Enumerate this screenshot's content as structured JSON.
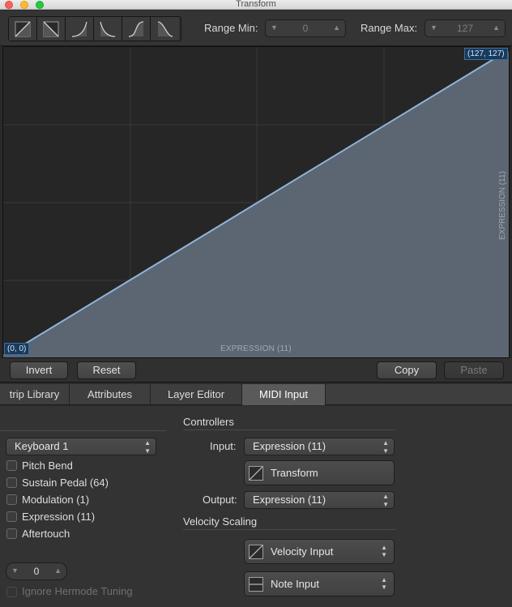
{
  "window": {
    "title": "Transform"
  },
  "toolbar": {
    "curve_buttons": [
      "linear-up-icon",
      "linear-down-icon",
      "exp-curve-icon",
      "log-curve-icon",
      "s-curve-icon",
      "bell-curve-icon"
    ],
    "range_min_label": "Range Min:",
    "range_min_value": "0",
    "range_max_label": "Range Max:",
    "range_max_value": "127"
  },
  "graph": {
    "start_point": "(0, 0)",
    "end_point": "(127, 127)",
    "x_axis_label": "EXPRESSION (11)",
    "y_axis_label": "EXPRESSION (11)",
    "line_color": "#8fb4d9",
    "fill_color": "#5b6672",
    "curve": {
      "x": [
        0,
        127
      ],
      "y": [
        0,
        127
      ]
    }
  },
  "buttons": {
    "invert": "Invert",
    "reset": "Reset",
    "copy": "Copy",
    "paste": "Paste"
  },
  "tabs": [
    "trip Library",
    "Attributes",
    "Layer Editor",
    "MIDI Input"
  ],
  "panel": {
    "source_popup": "Keyboard 1",
    "checkboxes": [
      "Pitch Bend",
      "Sustain Pedal (64)",
      "Modulation (1)",
      "Expression (11)",
      "Aftertouch"
    ],
    "stepper_value": "0",
    "hermode_label": "Ignore Hermode Tuning",
    "controllers_title": "Controllers",
    "input_label": "Input:",
    "input_value": "Expression (11)",
    "transform_button": "Transform",
    "output_label": "Output:",
    "output_value": "Expression (11)",
    "velocity_title": "Velocity Scaling",
    "velocity_input": "Velocity Input",
    "note_input": "Note Input"
  }
}
